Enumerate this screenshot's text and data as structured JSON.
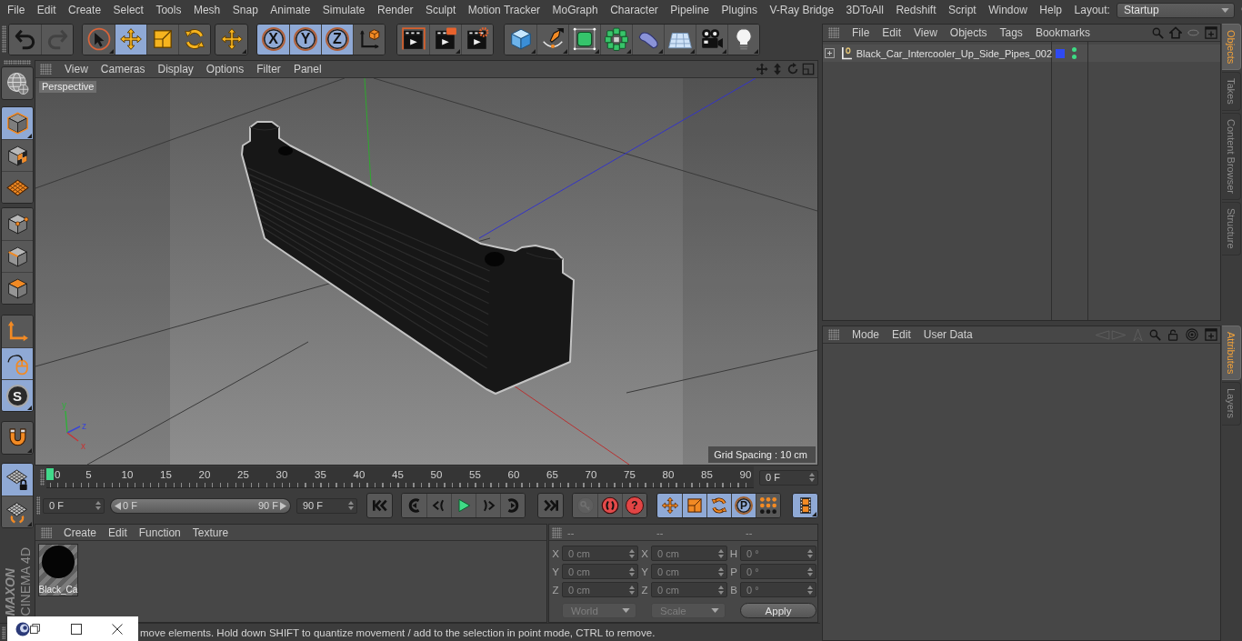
{
  "menu_bar": {
    "items": [
      "File",
      "Edit",
      "Create",
      "Select",
      "Tools",
      "Mesh",
      "Snap",
      "Animate",
      "Simulate",
      "Render",
      "Sculpt",
      "Motion Tracker",
      "MoGraph",
      "Character",
      "Pipeline",
      "Plugins",
      "V-Ray Bridge",
      "3DToAll",
      "Redshift",
      "Script",
      "Window",
      "Help"
    ],
    "layout_label": "Layout:",
    "layout_value": "Startup"
  },
  "toolbar": {
    "groups": [
      [
        {
          "kind": "undo",
          "selected": false,
          "disabled": false,
          "submenu": false
        },
        {
          "kind": "redo",
          "selected": false,
          "disabled": true,
          "submenu": false
        }
      ],
      [
        {
          "kind": "live-select",
          "selected": false,
          "disabled": false,
          "submenu": true
        },
        {
          "kind": "move",
          "selected": true,
          "disabled": false,
          "submenu": false
        },
        {
          "kind": "scale",
          "selected": false,
          "disabled": false,
          "submenu": false
        },
        {
          "kind": "rotate",
          "selected": false,
          "disabled": false,
          "submenu": false
        }
      ],
      [
        {
          "kind": "recent-move",
          "selected": false,
          "disabled": false,
          "submenu": true
        }
      ],
      [
        {
          "kind": "axis-lock",
          "label": "X",
          "selected": true,
          "disabled": false,
          "submenu": false
        },
        {
          "kind": "axis-lock",
          "label": "Y",
          "selected": true,
          "disabled": false,
          "submenu": false
        },
        {
          "kind": "axis-lock",
          "label": "Z",
          "selected": true,
          "disabled": false,
          "submenu": false
        },
        {
          "kind": "coord-system",
          "selected": false,
          "disabled": false,
          "submenu": false
        }
      ],
      [
        {
          "kind": "render-view",
          "selected": false,
          "disabled": false,
          "submenu": false
        },
        {
          "kind": "render-picture",
          "selected": false,
          "disabled": false,
          "submenu": true
        },
        {
          "kind": "render-settings",
          "selected": false,
          "disabled": false,
          "submenu": false
        }
      ],
      [
        {
          "kind": "cube",
          "selected": false,
          "disabled": false,
          "submenu": true
        },
        {
          "kind": "pen",
          "selected": false,
          "disabled": false,
          "submenu": true
        },
        {
          "kind": "subdivision",
          "selected": false,
          "disabled": false,
          "submenu": true
        },
        {
          "kind": "cloner",
          "selected": false,
          "disabled": false,
          "submenu": true
        },
        {
          "kind": "bend",
          "selected": false,
          "disabled": false,
          "submenu": true
        },
        {
          "kind": "floor",
          "selected": false,
          "disabled": false,
          "submenu": true
        },
        {
          "kind": "camera",
          "selected": false,
          "disabled": false,
          "submenu": true
        },
        {
          "kind": "light",
          "selected": false,
          "disabled": false,
          "submenu": true
        }
      ]
    ]
  },
  "tool_palette": {
    "groups": [
      [
        {
          "kind": "make-editable",
          "selected": false,
          "disabled": false,
          "submenu": false
        }
      ],
      [
        {
          "kind": "model",
          "selected": true,
          "disabled": false,
          "submenu": true
        },
        {
          "kind": "texture",
          "selected": false,
          "disabled": false,
          "submenu": false
        },
        {
          "kind": "workplane",
          "selected": false,
          "disabled": false,
          "submenu": false
        }
      ],
      [
        {
          "kind": "points",
          "selected": false,
          "disabled": false,
          "submenu": false
        },
        {
          "kind": "edges",
          "selected": false,
          "disabled": false,
          "submenu": false
        },
        {
          "kind": "polygons",
          "selected": false,
          "disabled": false,
          "submenu": false
        }
      ],
      [
        {
          "kind": "axis",
          "selected": false,
          "disabled": false,
          "submenu": false
        },
        {
          "kind": "tweak",
          "selected": true,
          "disabled": false,
          "submenu": false
        },
        {
          "kind": "snap",
          "label": "S",
          "selected": true,
          "disabled": false,
          "submenu": true
        }
      ],
      [
        {
          "kind": "magnet",
          "selected": false,
          "disabled": false,
          "submenu": true
        }
      ],
      [
        {
          "kind": "workplane-lock",
          "selected": true,
          "disabled": false,
          "submenu": false
        },
        {
          "kind": "workplane-align",
          "selected": false,
          "disabled": false,
          "submenu": true
        }
      ]
    ]
  },
  "viewport": {
    "menu": [
      "View",
      "Cameras",
      "Display",
      "Options",
      "Filter",
      "Panel"
    ],
    "camera_label": "Perspective",
    "grid_spacing": "Grid Spacing : 10 cm",
    "axis_labels": [
      {
        "text": "y",
        "color": "#2fb03a"
      },
      {
        "text": "z",
        "color": "#3a46d6"
      },
      {
        "text": "x",
        "color": "#c83434"
      }
    ]
  },
  "timeline": {
    "ticks": [
      "0",
      "5",
      "10",
      "15",
      "20",
      "25",
      "30",
      "35",
      "40",
      "45",
      "50",
      "55",
      "60",
      "65",
      "70",
      "75",
      "80",
      "85",
      "90"
    ],
    "playhead": {
      "level": 0
    },
    "current_frame": "0 F"
  },
  "playback": {
    "start_frame": "0 F",
    "range": {
      "start": "0 F",
      "end": "90 F",
      "level": 1
    },
    "end_frame": "90 F",
    "groups": [
      [
        {
          "kind": "go-start",
          "selected": false,
          "disabled": false,
          "submenu": false
        }
      ],
      [
        {
          "kind": "prev-key",
          "selected": false,
          "disabled": false,
          "submenu": false
        },
        {
          "kind": "prev-frame",
          "selected": false,
          "disabled": false,
          "submenu": false
        },
        {
          "kind": "play",
          "selected": false,
          "disabled": false,
          "submenu": false
        },
        {
          "kind": "next-frame",
          "selected": false,
          "disabled": false,
          "submenu": false
        },
        {
          "kind": "next-key",
          "selected": false,
          "disabled": false,
          "submenu": false
        }
      ],
      [
        {
          "kind": "go-end",
          "selected": false,
          "disabled": false,
          "submenu": false
        }
      ],
      [
        {
          "kind": "record",
          "selected": false,
          "disabled": true,
          "submenu": false
        },
        {
          "kind": "autokey",
          "selected": false,
          "disabled": false,
          "submenu": false
        },
        {
          "kind": "key-help",
          "label": "?",
          "selected": false,
          "disabled": false,
          "submenu": false
        }
      ],
      [
        {
          "kind": "key-position",
          "selected": true,
          "disabled": false,
          "submenu": false
        },
        {
          "kind": "key-scale",
          "selected": true,
          "disabled": false,
          "submenu": false
        },
        {
          "kind": "key-rotation",
          "selected": true,
          "disabled": false,
          "submenu": false
        },
        {
          "kind": "key-parameter",
          "label": "P",
          "selected": true,
          "disabled": false,
          "submenu": false
        },
        {
          "kind": "key-pla",
          "selected": false,
          "disabled": false,
          "submenu": false
        }
      ],
      [
        {
          "kind": "timeline-window",
          "selected": true,
          "disabled": false,
          "submenu": true
        }
      ]
    ]
  },
  "material_manager": {
    "menu": [
      "Create",
      "Edit",
      "Function",
      "Texture"
    ],
    "materials": [
      {
        "name": "Black_Ca"
      }
    ]
  },
  "coordinates": {
    "headers": [
      "--",
      "--",
      "--"
    ],
    "rows": [
      [
        {
          "axis": "X",
          "value": "0 cm"
        },
        {
          "axis": "X",
          "value": "0 cm"
        },
        {
          "axis": "H",
          "value": "0 °"
        }
      ],
      [
        {
          "axis": "Y",
          "value": "0 cm"
        },
        {
          "axis": "Y",
          "value": "0 cm"
        },
        {
          "axis": "P",
          "value": "0 °"
        }
      ],
      [
        {
          "axis": "Z",
          "value": "0 cm"
        },
        {
          "axis": "Z",
          "value": "0 cm"
        },
        {
          "axis": "B",
          "value": "0 °"
        }
      ]
    ],
    "dropdowns": [
      {
        "value": "World",
        "disabled": true
      },
      {
        "value": "Scale",
        "disabled": true
      }
    ],
    "apply_label": "Apply"
  },
  "object_manager": {
    "menu": [
      "File",
      "Edit",
      "View",
      "Objects",
      "Tags",
      "Bookmarks"
    ],
    "objects": [
      {
        "name": "Black_Car_Intercooler_Up_Side_Pipes_002",
        "expanded": false,
        "color": "#2f4af2",
        "visible_in_editor": true,
        "visible_in_render": true
      }
    ]
  },
  "attribute_manager": {
    "menu": [
      "Mode",
      "Edit",
      "User Data"
    ]
  },
  "side_tabs": {
    "upper": [
      {
        "label": "Objects",
        "selected": true
      },
      {
        "label": "Takes",
        "selected": false
      },
      {
        "label": "Content Browser",
        "selected": false
      },
      {
        "label": "Structure",
        "selected": false
      }
    ],
    "lower": [
      {
        "label": "Attributes",
        "selected": true
      },
      {
        "label": "Layers",
        "selected": false
      }
    ]
  },
  "logo": {
    "brand": "MAXON",
    "product": "CINEMA 4D"
  },
  "status_bar": {
    "text": "move elements. Hold down SHIFT to quantize movement / add to the selection in point mode, CTRL to remove."
  }
}
